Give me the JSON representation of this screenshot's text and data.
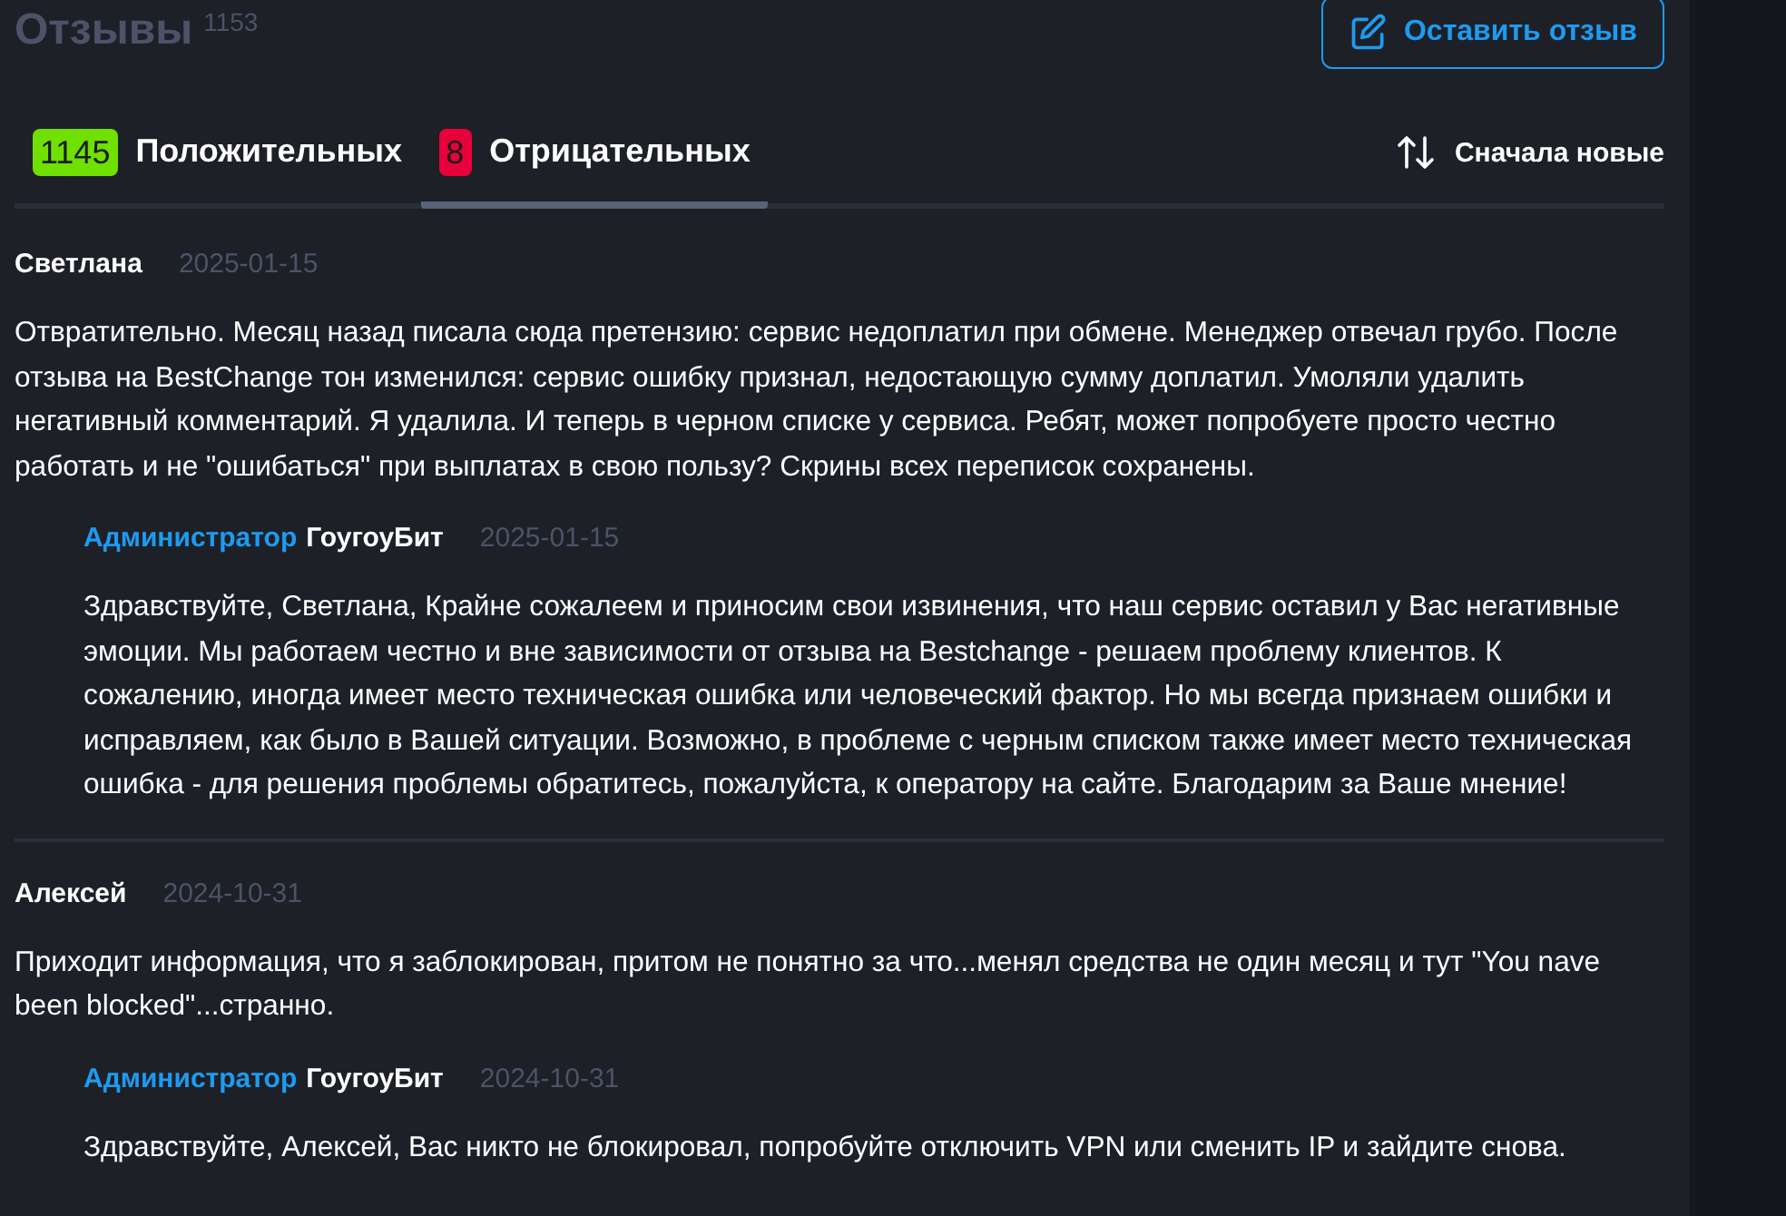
{
  "header": {
    "title": "Отзывы",
    "count": "1153",
    "button": "Оставить отзыв"
  },
  "tabs": [
    {
      "count": "1145",
      "label": "Положительных",
      "kind": "positive",
      "selected": false
    },
    {
      "count": "8",
      "label": "Отрицательных",
      "kind": "negative",
      "selected": true
    }
  ],
  "sort": {
    "label": "Сначала новые"
  },
  "reviews": [
    {
      "author": "Светлана",
      "date": "2025-01-15",
      "text": "Отвратительно. Месяц назад писала сюда претензию: сервис недоплатил при обмене. Менеджер отвечал грубо. После отзыва на BestChange тон изменился: сервис ошибку признал, недостающую сумму доплатил. Умоляли удалить негативный комментарий. Я удалила. И теперь в черном списке у сервиса. Ребят, может попробуете просто честно работать и не \"ошибаться\" при выплатах в свою пользу? Скрины всех переписок сохранены.",
      "reply": {
        "role": "Администратор",
        "name": "ГоугоуБит",
        "date": "2025-01-15",
        "text": "Здравствуйте, Светлана, Крайне сожалеем и приносим свои извинения, что наш сервис оставил у Вас негативные эмоции. Мы работаем честно и вне зависимости от отзыва на Bestchange - решаем проблему клиентов. К сожалению, иногда имеет место техническая ошибка или человеческий фактор. Но мы всегда признаем ошибки и исправляем, как было в Вашей ситуации. Возможно, в проблеме с черным списком также имеет место техническая ошибка - для решения проблемы обратитесь, пожалуйста, к оператору на сайте. Благодарим за Ваше мнение!"
      }
    },
    {
      "author": "Алексей",
      "date": "2024-10-31",
      "text": "Приходит информация, что я заблокирован, притом не понятно за что...менял средства не один месяц и тут \"You nave been blocked\"...странно.",
      "reply": {
        "role": "Администратор",
        "name": "ГоугоуБит",
        "date": "2024-10-31",
        "text": "Здравствуйте, Алексей, Вас никто не блокировал, попробуйте отключить VPN или сменить IP и зайдите снова."
      }
    }
  ]
}
